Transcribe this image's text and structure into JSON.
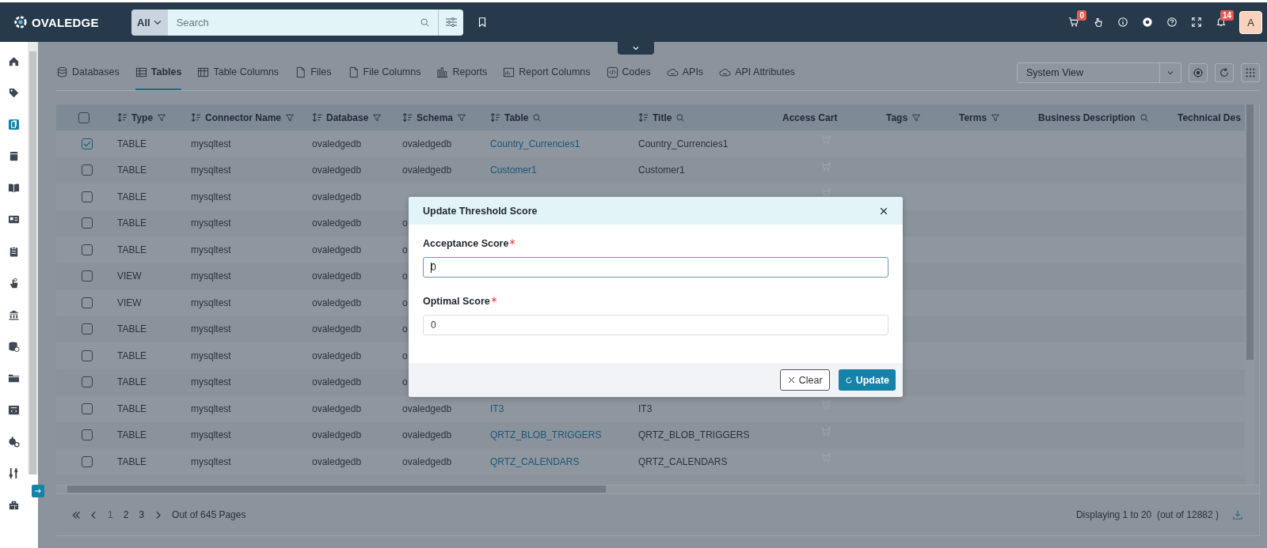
{
  "header": {
    "logo": "OVALEDGE",
    "search": {
      "scope": "All",
      "placeholder": "Search"
    },
    "cart_badge": "0",
    "notification_badge": "14",
    "avatar": "A"
  },
  "sidebar": {
    "items": [
      {
        "kind": "home",
        "selected": false
      },
      {
        "kind": "tag",
        "selected": false
      },
      {
        "kind": "documents",
        "selected": true
      },
      {
        "kind": "archive",
        "selected": false
      },
      {
        "kind": "book",
        "selected": false
      },
      {
        "kind": "card",
        "selected": false
      },
      {
        "kind": "clipboard",
        "selected": false
      },
      {
        "kind": "hand",
        "selected": false
      },
      {
        "kind": "bank",
        "selected": false
      },
      {
        "kind": "database",
        "selected": false
      },
      {
        "kind": "folder",
        "selected": false
      },
      {
        "kind": "code",
        "selected": false
      },
      {
        "kind": "gears",
        "selected": false
      },
      {
        "kind": "tools",
        "selected": false
      },
      {
        "kind": "building",
        "selected": false
      }
    ]
  },
  "tabs": [
    {
      "label": "Databases",
      "kind": "database",
      "selected": false
    },
    {
      "label": "Tables",
      "kind": "table",
      "selected": true
    },
    {
      "label": "Table Columns",
      "kind": "columns",
      "selected": false
    },
    {
      "label": "Files",
      "kind": "file",
      "selected": false
    },
    {
      "label": "File Columns",
      "kind": "file",
      "selected": false
    },
    {
      "label": "Reports",
      "kind": "bars",
      "selected": false
    },
    {
      "label": "Report Columns",
      "kind": "report",
      "selected": false
    },
    {
      "label": "Codes",
      "kind": "code",
      "selected": false
    },
    {
      "label": "APIs",
      "kind": "cloud",
      "selected": false
    },
    {
      "label": "API Attributes",
      "kind": "cloud",
      "selected": false
    }
  ],
  "view_select": {
    "value": "System View"
  },
  "table": {
    "all_checked": false,
    "columns": [
      {
        "label": "Type",
        "sortable": true,
        "kind": "filter"
      },
      {
        "label": "Connector Name",
        "sortable": true,
        "kind": "filter"
      },
      {
        "label": "Database",
        "sortable": true,
        "kind": "filter"
      },
      {
        "label": "Schema",
        "sortable": true,
        "kind": "filter"
      },
      {
        "label": "Table",
        "sortable": true,
        "kind": "search"
      },
      {
        "label": "Title",
        "sortable": true,
        "kind": "search"
      },
      {
        "label": "Access Cart",
        "sortable": false,
        "kind": "plain"
      },
      {
        "label": "Tags",
        "sortable": false,
        "kind": "filter"
      },
      {
        "label": "Terms",
        "sortable": false,
        "kind": "filter"
      },
      {
        "label": "Business Description",
        "sortable": false,
        "kind": "search"
      },
      {
        "label": "Technical Des",
        "sortable": false,
        "kind": "plain"
      }
    ],
    "rows": [
      {
        "checked": true,
        "type": "TABLE",
        "connector": "mysqltest",
        "database": "ovaledgedb",
        "schema": "ovaledgedb",
        "table": "Country_Currencies1",
        "title": "Country_Currencies1",
        "cart": true
      },
      {
        "checked": false,
        "type": "TABLE",
        "connector": "mysqltest",
        "database": "ovaledgedb",
        "schema": "ovaledgedb",
        "table": "Customer1",
        "title": "Customer1",
        "cart": true
      },
      {
        "checked": false,
        "type": "TABLE",
        "connector": "mysqltest",
        "database": "ovaledgedb",
        "cart": true
      },
      {
        "checked": false,
        "type": "TABLE",
        "connector": "mysqltest",
        "database": "ovaledgedb",
        "schema": "o"
      },
      {
        "checked": false,
        "type": "TABLE",
        "connector": "mysqltest",
        "database": "ovaledgedb",
        "schema": "o"
      },
      {
        "checked": false,
        "type": "VIEW",
        "connector": "mysqltest",
        "database": "ovaledgedb",
        "schema": "o"
      },
      {
        "checked": false,
        "type": "VIEW",
        "connector": "mysqltest",
        "database": "ovaledgedb",
        "schema": "o"
      },
      {
        "checked": false,
        "type": "TABLE",
        "connector": "mysqltest",
        "database": "ovaledgedb",
        "schema": "o"
      },
      {
        "checked": false,
        "type": "TABLE",
        "connector": "mysqltest",
        "database": "ovaledgedb",
        "schema": "o"
      },
      {
        "checked": false,
        "type": "TABLE",
        "connector": "mysqltest",
        "database": "ovaledgedb",
        "schema": "o"
      },
      {
        "checked": false,
        "type": "TABLE",
        "connector": "mysqltest",
        "database": "ovaledgedb",
        "schema": "ovaledgedb",
        "table": "IT3",
        "title": "IT3",
        "cart": true
      },
      {
        "checked": false,
        "type": "TABLE",
        "connector": "mysqltest",
        "database": "ovaledgedb",
        "schema": "ovaledgedb",
        "table": "QRTZ_BLOB_TRIGGERS",
        "title": "QRTZ_BLOB_TRIGGERS",
        "cart": true
      },
      {
        "checked": false,
        "type": "TABLE",
        "connector": "mysqltest",
        "database": "ovaledgedb",
        "schema": "ovaledgedb",
        "table": "QRTZ_CALENDARS",
        "title": "QRTZ_CALENDARS",
        "cart": true
      }
    ]
  },
  "pagination": {
    "pages": [
      {
        "label": "1",
        "selected": true
      },
      {
        "label": "2",
        "selected": false
      },
      {
        "label": "3",
        "selected": false
      }
    ],
    "summary": "Out of 645 Pages",
    "display": "Displaying 1 to 20  (out of 12882 )"
  },
  "dialog": {
    "title": "Update Threshold Score",
    "fields": [
      {
        "label": "Acceptance Score",
        "required": true,
        "value": "0",
        "focused": true
      },
      {
        "label": "Optimal Score",
        "required": true,
        "value": "0",
        "focused": false
      }
    ],
    "buttons": [
      {
        "label": "Clear",
        "kind": "clear"
      },
      {
        "label": "Update",
        "kind": "update"
      }
    ]
  }
}
